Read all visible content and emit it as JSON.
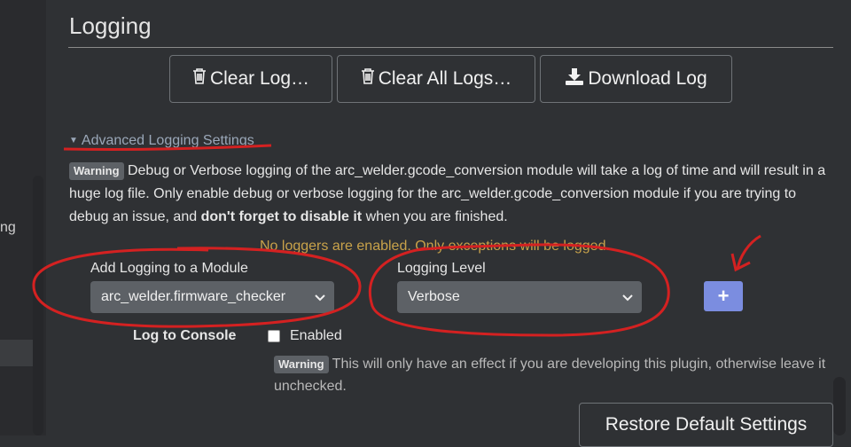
{
  "left_partial_text": "ng",
  "section": {
    "title": "Logging"
  },
  "buttons": {
    "clear_log": "Clear Log…",
    "clear_all_logs": "Clear All Logs…",
    "download_log": "Download Log"
  },
  "advanced": {
    "link_label": "Advanced Logging Settings",
    "warning_badge": "Warning",
    "warning_text_1": " Debug or Verbose logging of the arc_welder.gcode_conversion module will take a log of time and will result in a huge log file. Only enable debug or verbose logging for the arc_welder.gcode_conversion module if you are trying to debug an issue, and ",
    "warning_bold": "don't forget to disable it",
    "warning_text_2": " when you are finished."
  },
  "status": {
    "no_loggers": "No loggers are enabled. Only exceptions will be logged."
  },
  "module_field": {
    "label": "Add Logging to a Module",
    "value": "arc_welder.firmware_checker"
  },
  "level_field": {
    "label": "Logging Level",
    "value": "Verbose"
  },
  "add_button": {
    "label": "+"
  },
  "console": {
    "label": "Log to Console",
    "checkbox_label": "Enabled",
    "checked": false,
    "warning_badge": "Warning",
    "warning_text": " This will only have an effect if you are developing this plugin, otherwise leave it unchecked."
  },
  "restore_button": "Restore Default Settings",
  "colors": {
    "background": "#2f3134",
    "select_bg": "#5d6166",
    "add_button": "#7b8de0",
    "status_text": "#c8a24a",
    "annotation": "#d42121"
  }
}
